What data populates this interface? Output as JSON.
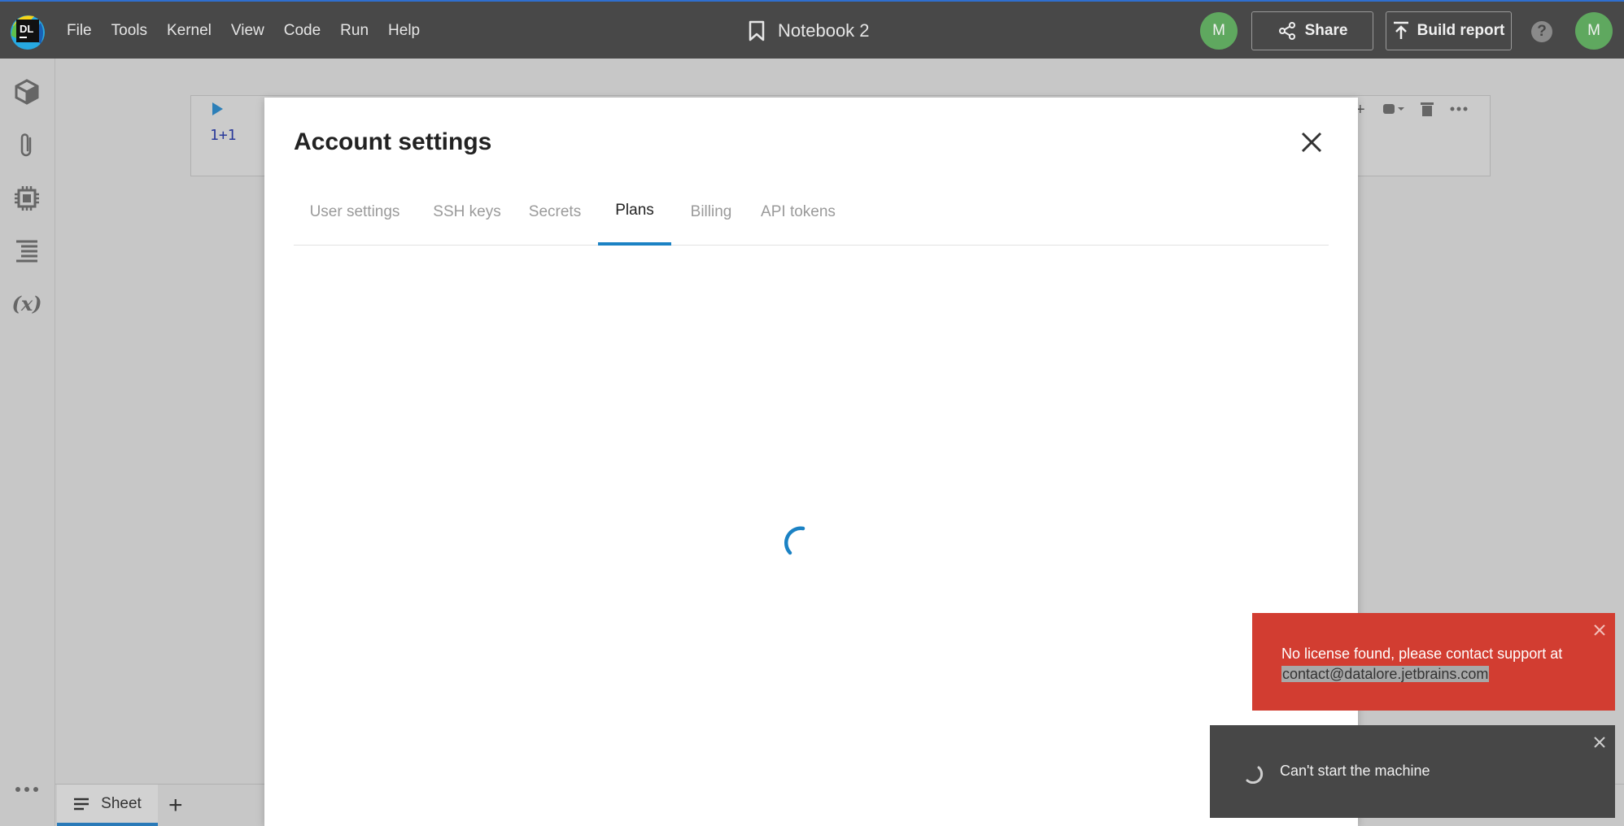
{
  "topbar": {
    "logo_text": "DL",
    "menu": [
      "File",
      "Tools",
      "Kernel",
      "View",
      "Code",
      "Run",
      "Help"
    ],
    "title": "Notebook 2",
    "avatar_left": "M",
    "share_label": "Share",
    "build_report_label": "Build report",
    "help_symbol": "?",
    "avatar_right": "M"
  },
  "leftrail": {
    "icons": [
      "cube-icon",
      "paperclip-icon",
      "chip-icon",
      "outline-icon",
      "variables-icon",
      "more-icon"
    ],
    "variables_text": "(x)"
  },
  "cell": {
    "code": "1+1"
  },
  "sheets": {
    "tab_label": "Sheet",
    "add_symbol": "+"
  },
  "modal": {
    "title": "Account settings",
    "tabs": [
      {
        "label": "User settings",
        "active": false
      },
      {
        "label": "SSH keys",
        "active": false
      },
      {
        "label": "Secrets",
        "active": false
      },
      {
        "label": "Plans",
        "active": true
      },
      {
        "label": "Billing",
        "active": false
      },
      {
        "label": "API tokens",
        "active": false
      }
    ]
  },
  "toasts": {
    "error_text": "No license found, please contact support at",
    "error_email": "contact@datalore.jetbrains.com",
    "machine_text": "Can't start the machine"
  },
  "colors": {
    "accent": "#1b82c4",
    "error": "#d23d31",
    "topbar": "#484848"
  }
}
